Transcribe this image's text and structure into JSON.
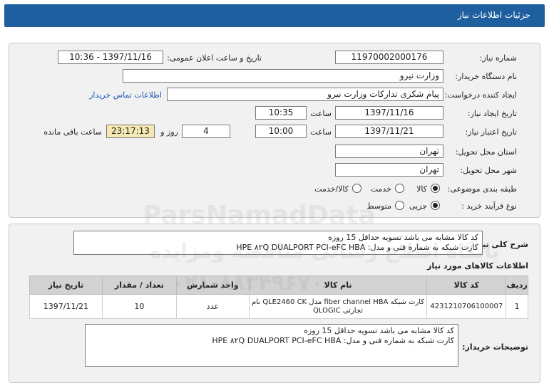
{
  "window": {
    "title": "جزئیات اطلاعات نیاز"
  },
  "form": {
    "need_number_label": "شماره نیاز:",
    "need_number": "1197000200017­6",
    "announce_label": "تاریخ و ساعت اعلان عمومی:",
    "announce_value": "1397/11/16 - 10:36",
    "buyer_org_label": "نام دستگاه خریدار:",
    "buyer_org": "وزارت نیرو",
    "requester_label": "ایجاد کننده درخواست:",
    "requester": "پیام شکری تدارکات وزارت نیرو",
    "contact_link": "اطلاعات تماس خریدار",
    "created_label": "تاریخ ایجاد نیاز:",
    "created_date": "1397/11/16",
    "time_label": "ساعت",
    "created_time": "10:35",
    "validity_label": "تاریخ اعتبار نیاز:",
    "validity_date": "1397/11/21",
    "validity_time": "10:00",
    "days_value": "4",
    "days_label": "روز و",
    "remaining_time": "23:17:13",
    "remaining_label": "ساعت باقی مانده",
    "province_label": "استان محل تحویل:",
    "province": "تهران",
    "city_label": "شهر محل تحویل:",
    "city": "تهران",
    "category_label": "طبقه بندی موضوعی:",
    "category_options": [
      "کالا",
      "خدمت",
      "کالا/خدمت"
    ],
    "category_selected": "کالا",
    "process_label": "نوع فرآیند خرید :",
    "process_options": [
      "جزیی",
      "متوسط"
    ],
    "process_selected": "جزیی"
  },
  "summary": {
    "label": "شرح کلی نیاز:",
    "line1": "کد کالا مشابه می باشد تسویه حداقل 15 روزه",
    "line2": "کارت شبکه به شماره فنی و مدل: HPE ۸۲Q DUALPORT PCI-eFC HBA"
  },
  "items": {
    "section_title": "اطلاعات کالاهای مورد نیاز",
    "headers": [
      "ردیف",
      "کد کالا",
      "نام کالا",
      "واحد شمارش",
      "تعداد / مقدار",
      "تاریخ نیاز"
    ],
    "rows": [
      {
        "row": "1",
        "code": "4231210706100007",
        "name": "کارت شبکه fiber channel HBA مدل QLE2460 CK نام تجارتی QLOGIC",
        "unit": "عدد",
        "qty": "10",
        "date": "1397/11/21"
      }
    ]
  },
  "buyer_notes": {
    "label": "توضیحات خریدار:",
    "line1": "کد کالا مشابه می باشد تسویه حداقل 15 روزه",
    "line2": "کارت شبکه به شماره فنی و مدل: HPE ۸۲Q DUALPORT PCI-eFC HBA"
  },
  "watermark": {
    "text": "ParsNamadData",
    "phone": "۰۲۱-۸۸۳۴۹۶۷۰",
    "org_line": "پایگاه اطلاع رسانی مناقصه ومزایده"
  }
}
